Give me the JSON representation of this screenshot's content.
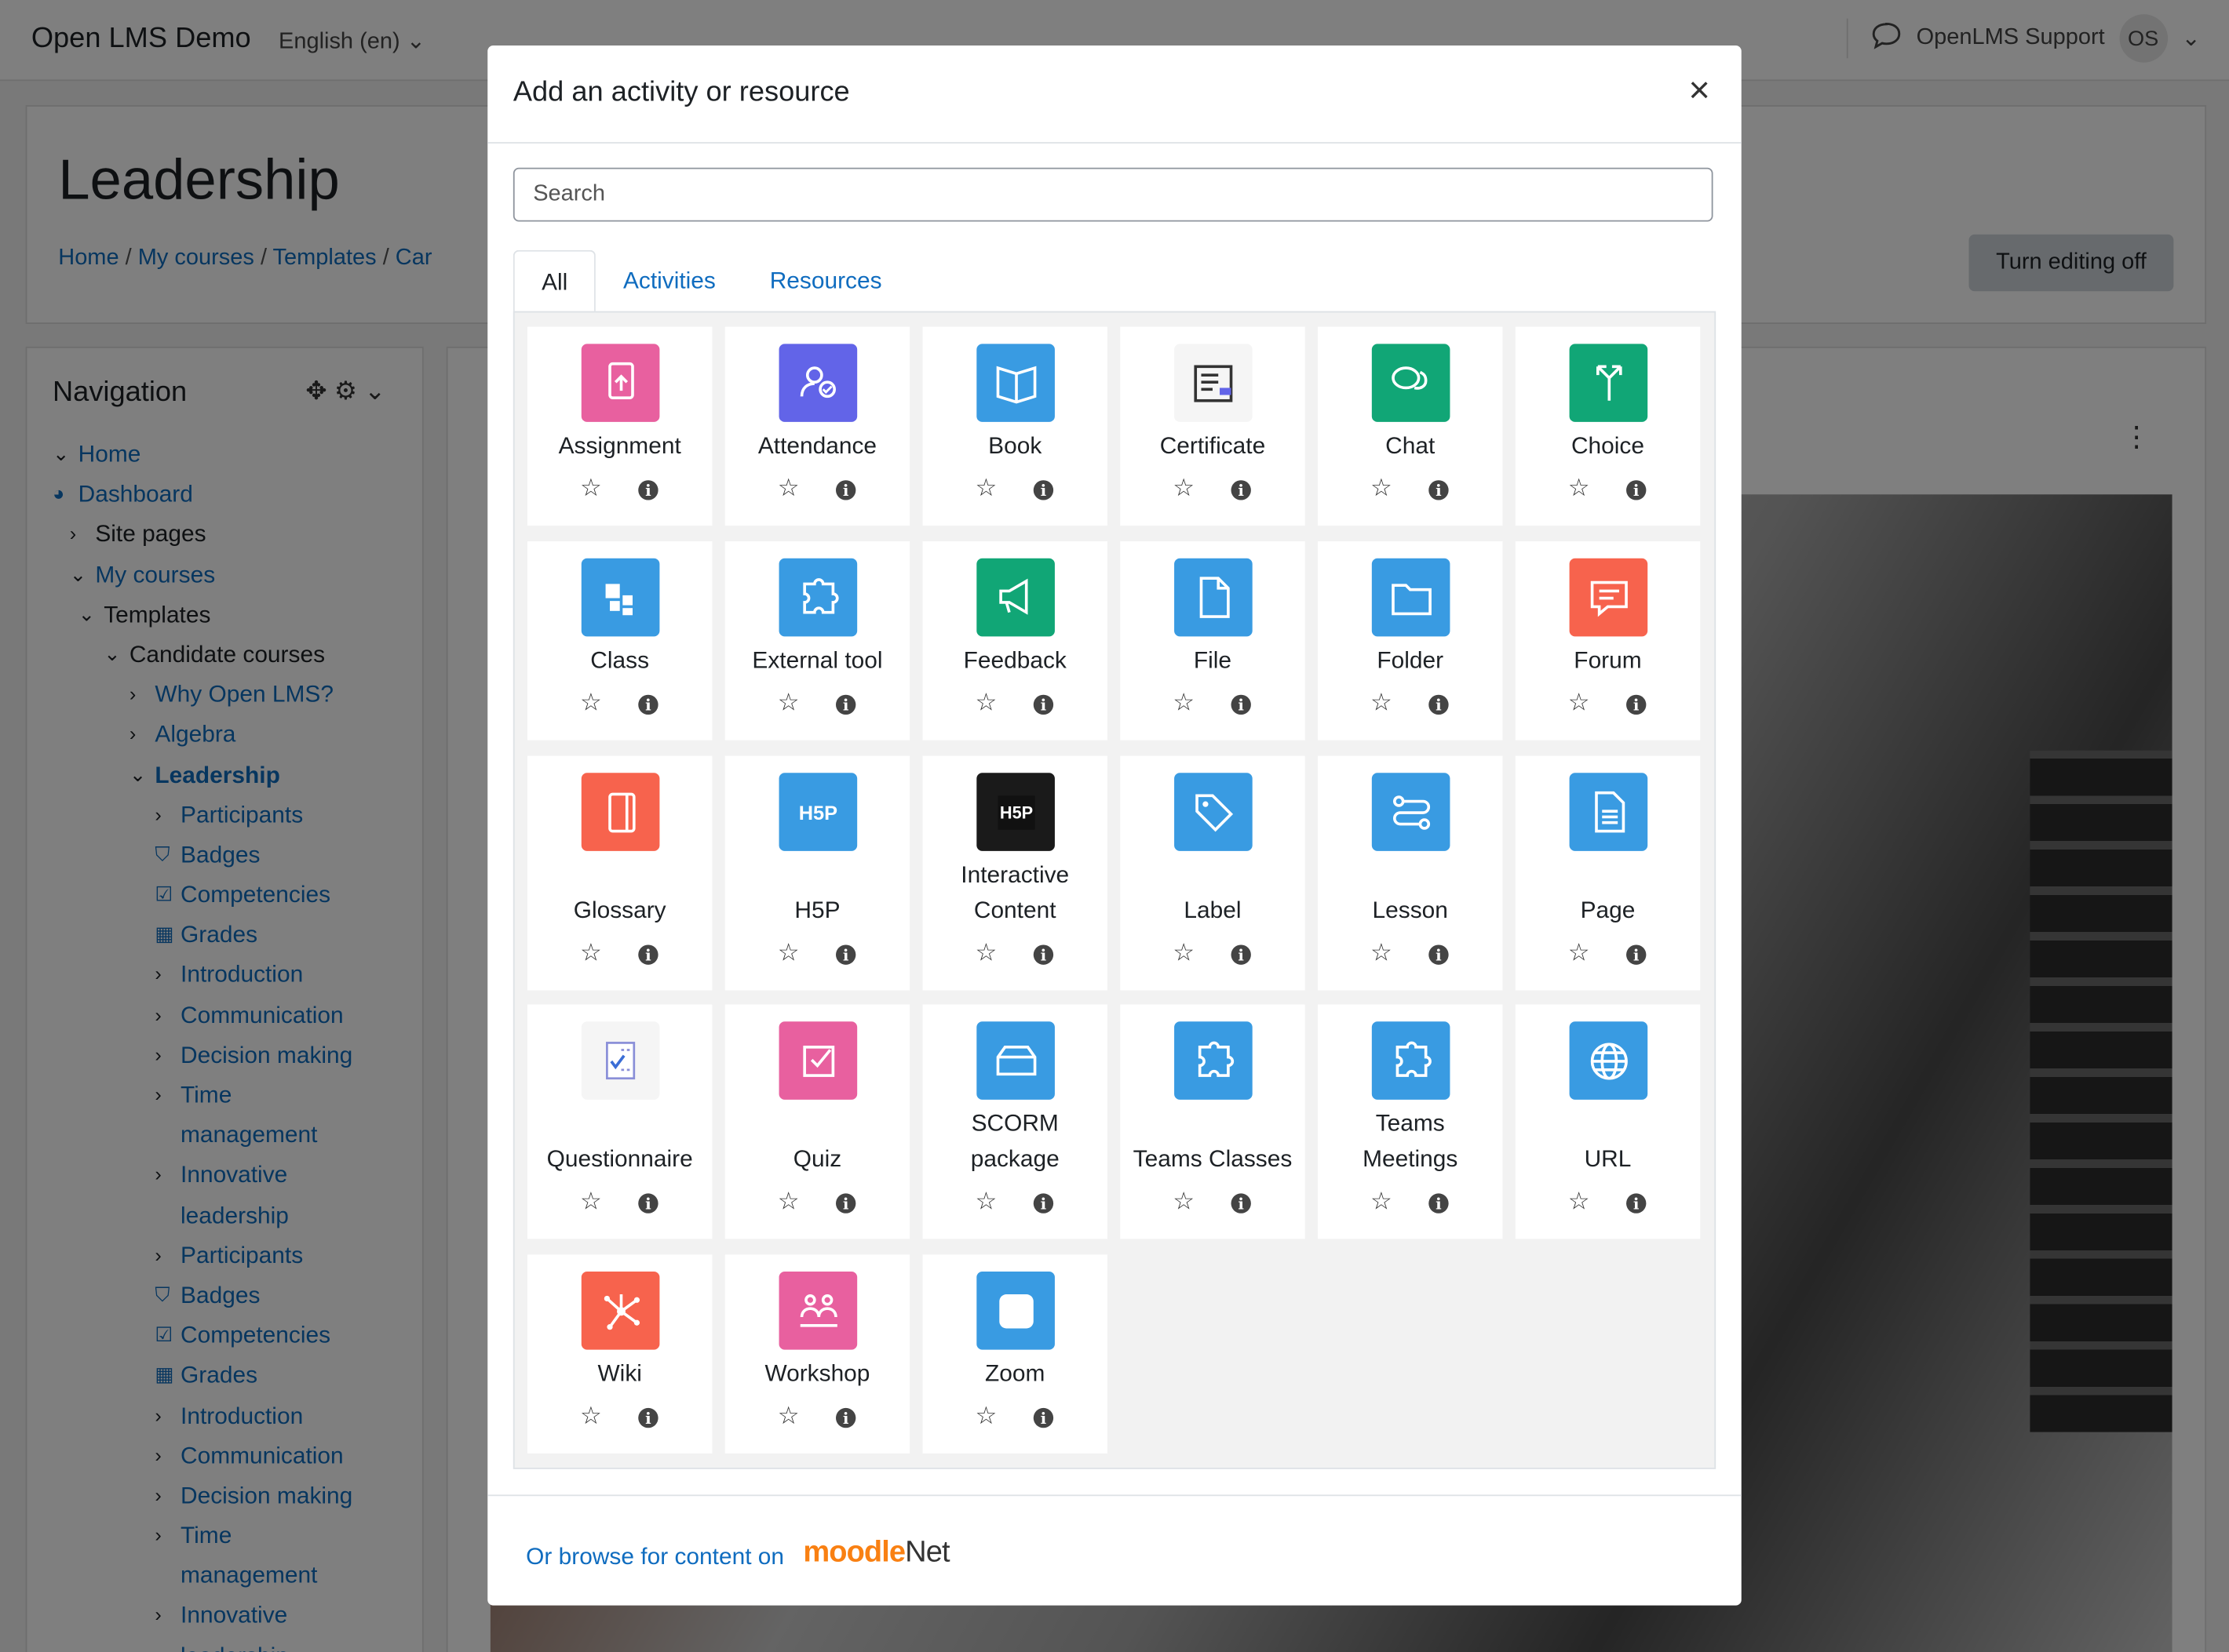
{
  "header": {
    "site_name": "Open LMS Demo",
    "language": "English (en)",
    "user_name": "OpenLMS Support",
    "user_initials": "OS"
  },
  "course": {
    "title": "Leadership",
    "breadcrumb": [
      "Home",
      "My courses",
      "Templates",
      "Car"
    ],
    "edit_button": "Turn editing off"
  },
  "navigation": {
    "title": "Navigation",
    "items": [
      {
        "label": "Home",
        "level": 0,
        "icon": "chevron-down",
        "style": "link"
      },
      {
        "label": "Dashboard",
        "level": 0,
        "icon": "dashboard",
        "style": "link"
      },
      {
        "label": "Site pages",
        "level": 1,
        "icon": "chevron-right",
        "style": "plain"
      },
      {
        "label": "My courses",
        "level": 1,
        "icon": "chevron-down",
        "style": "link"
      },
      {
        "label": "Templates",
        "level": 2,
        "icon": "chevron-down",
        "style": "plain"
      },
      {
        "label": "Candidate courses",
        "level": 3,
        "icon": "chevron-down",
        "style": "plain"
      },
      {
        "label": "Why Open LMS?",
        "level": 4,
        "icon": "chevron-right",
        "style": "link"
      },
      {
        "label": "Algebra",
        "level": 4,
        "icon": "chevron-right",
        "style": "link"
      },
      {
        "label": "Leadership",
        "level": 4,
        "icon": "chevron-down",
        "style": "link bold"
      },
      {
        "label": "Participants",
        "level": 5,
        "icon": "chevron-right",
        "style": "link"
      },
      {
        "label": "Badges",
        "level": 5,
        "icon": "shield",
        "style": "link"
      },
      {
        "label": "Competencies",
        "level": 5,
        "icon": "check-square",
        "style": "link"
      },
      {
        "label": "Grades",
        "level": 5,
        "icon": "table",
        "style": "link"
      },
      {
        "label": "Introduction",
        "level": 5,
        "icon": "chevron-right",
        "style": "link"
      },
      {
        "label": "Communication",
        "level": 5,
        "icon": "chevron-right",
        "style": "link"
      },
      {
        "label": "Decision making",
        "level": 5,
        "icon": "chevron-right",
        "style": "link"
      },
      {
        "label": "Time",
        "level": 5,
        "icon": "chevron-right",
        "style": "link"
      },
      {
        "label": "management",
        "level": 4,
        "icon": "",
        "style": "link"
      },
      {
        "label": "Innovative",
        "level": 5,
        "icon": "chevron-right",
        "style": "link"
      },
      {
        "label": "leadership",
        "level": 4,
        "icon": "",
        "style": "link"
      },
      {
        "label": "Participants",
        "level": 5,
        "icon": "chevron-right",
        "style": "link"
      },
      {
        "label": "Badges",
        "level": 5,
        "icon": "shield",
        "style": "link"
      },
      {
        "label": "Competencies",
        "level": 5,
        "icon": "check-square",
        "style": "link"
      },
      {
        "label": "Grades",
        "level": 5,
        "icon": "table",
        "style": "link"
      },
      {
        "label": "Introduction",
        "level": 5,
        "icon": "chevron-right",
        "style": "link"
      },
      {
        "label": "Communication",
        "level": 5,
        "icon": "chevron-right",
        "style": "link"
      },
      {
        "label": "Decision making",
        "level": 5,
        "icon": "chevron-right",
        "style": "link"
      },
      {
        "label": "Time",
        "level": 5,
        "icon": "chevron-right",
        "style": "link"
      },
      {
        "label": "management",
        "level": 4,
        "icon": "",
        "style": "link"
      },
      {
        "label": "Innovative",
        "level": 5,
        "icon": "chevron-right",
        "style": "link"
      },
      {
        "label": "leadership",
        "level": 4,
        "icon": "",
        "style": "link"
      }
    ]
  },
  "modal": {
    "title": "Add an activity or resource",
    "search_placeholder": "Search",
    "tabs": [
      {
        "label": "All",
        "active": true
      },
      {
        "label": "Activities",
        "active": false
      },
      {
        "label": "Resources",
        "active": false
      }
    ],
    "modules": [
      {
        "name": "Assignment",
        "icon": "assignment-icon",
        "color": "#e8609f"
      },
      {
        "name": "Attendance",
        "icon": "attendance-icon",
        "color": "#6264e8"
      },
      {
        "name": "Book",
        "icon": "book-icon",
        "color": "#399be2"
      },
      {
        "name": "Certificate",
        "icon": "certificate-icon",
        "color": "#f5f5f5"
      },
      {
        "name": "Chat",
        "icon": "chat-icon",
        "color": "#11a676"
      },
      {
        "name": "Choice",
        "icon": "choice-icon",
        "color": "#11a676"
      },
      {
        "name": "Class",
        "icon": "class-icon",
        "color": "#399be2"
      },
      {
        "name": "External tool",
        "icon": "external-tool-icon",
        "color": "#399be2"
      },
      {
        "name": "Feedback",
        "icon": "feedback-icon",
        "color": "#11a676"
      },
      {
        "name": "File",
        "icon": "file-icon",
        "color": "#399be2"
      },
      {
        "name": "Folder",
        "icon": "folder-icon",
        "color": "#399be2"
      },
      {
        "name": "Forum",
        "icon": "forum-icon",
        "color": "#f7634d"
      },
      {
        "name": "Glossary",
        "icon": "glossary-icon",
        "color": "#f7634d"
      },
      {
        "name": "H5P",
        "icon": "h5p-icon",
        "color": "#399be2"
      },
      {
        "name": "Interactive Content",
        "icon": "interactive-content-icon",
        "color": "#1a1a1a"
      },
      {
        "name": "Label",
        "icon": "label-icon",
        "color": "#399be2"
      },
      {
        "name": "Lesson",
        "icon": "lesson-icon",
        "color": "#399be2"
      },
      {
        "name": "Page",
        "icon": "page-icon",
        "color": "#399be2"
      },
      {
        "name": "Questionnaire",
        "icon": "questionnaire-icon",
        "color": "#f5f5f5"
      },
      {
        "name": "Quiz",
        "icon": "quiz-icon",
        "color": "#e8609f"
      },
      {
        "name": "SCORM package",
        "icon": "scorm-icon",
        "color": "#399be2"
      },
      {
        "name": "Teams Classes",
        "icon": "teams-classes-icon",
        "color": "#399be2"
      },
      {
        "name": "Teams Meetings",
        "icon": "teams-meetings-icon",
        "color": "#399be2"
      },
      {
        "name": "URL",
        "icon": "url-icon",
        "color": "#399be2"
      },
      {
        "name": "Wiki",
        "icon": "wiki-icon",
        "color": "#f7634d"
      },
      {
        "name": "Workshop",
        "icon": "workshop-icon",
        "color": "#e8609f"
      },
      {
        "name": "Zoom",
        "icon": "zoom-icon",
        "color": "#399be2"
      }
    ],
    "footer": {
      "link_text": "Or browse for content on",
      "brand": "moodle",
      "brand_suffix": "Net"
    }
  }
}
